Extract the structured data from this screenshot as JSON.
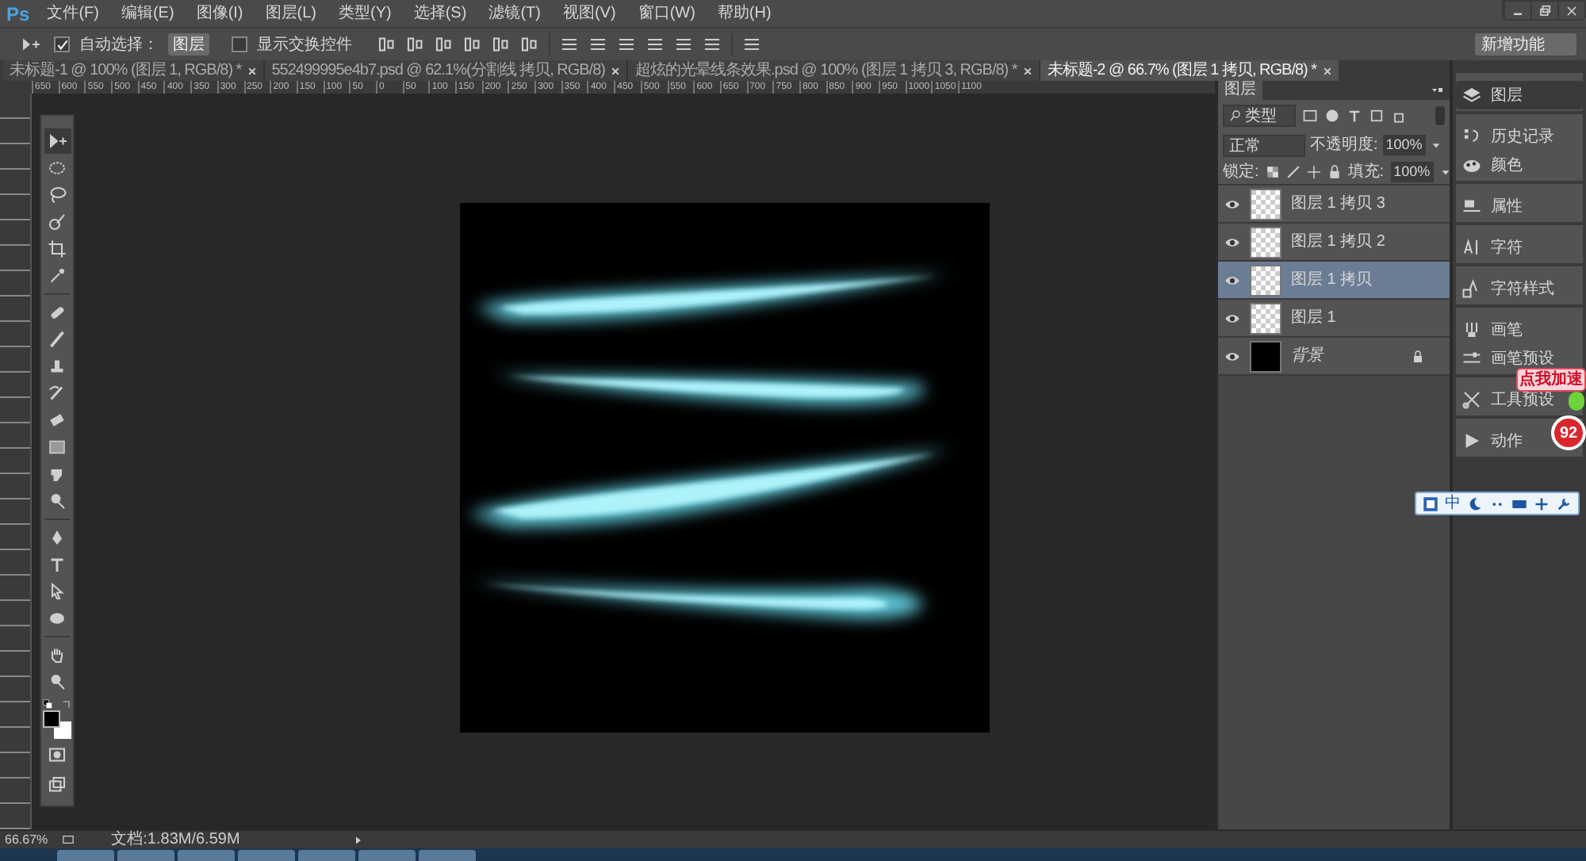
{
  "app_logo": "Ps",
  "menu": [
    "文件(F)",
    "编辑(E)",
    "图像(I)",
    "图层(L)",
    "类型(Y)",
    "选择(S)",
    "滤镜(T)",
    "视图(V)",
    "窗口(W)",
    "帮助(H)"
  ],
  "options_bar": {
    "auto_select": {
      "label": "自动选择：",
      "checked": true
    },
    "auto_select_target": "图层",
    "show_transform": {
      "label": "显示交换控件",
      "checked": false
    }
  },
  "workspace": "新增功能",
  "tabs": [
    {
      "label": "未标题-1 @ 100% (图层 1, RGB/8) *",
      "selected": false
    },
    {
      "label": "552499995e4b7.psd @ 62.1%(分割线 拷贝, RGB/8)",
      "selected": false
    },
    {
      "label": "超炫的光晕线条效果.psd @ 100% (图层 1 拷贝 3, RGB/8) *",
      "selected": false
    },
    {
      "label": "未标题-2 @ 66.7% (图层 1 拷贝, RGB/8) *",
      "selected": true
    }
  ],
  "ruler": [
    "650",
    "600",
    "550",
    "500",
    "450",
    "400",
    "350",
    "300",
    "250",
    "200",
    "150",
    "100",
    "50",
    "0",
    "50",
    "100",
    "150",
    "200",
    "250",
    "300",
    "350",
    "400",
    "450",
    "500",
    "550",
    "600",
    "650",
    "700",
    "750",
    "800",
    "850",
    "900",
    "950",
    "1000",
    "1050",
    "1100"
  ],
  "layers_panel": {
    "title": "图层",
    "filter": "类型",
    "blend_mode": "正常",
    "opacity_label": "不透明度:",
    "opacity": "100%",
    "lock_label": "锁定:",
    "fill_label": "填充:",
    "fill": "100%",
    "layers": [
      {
        "name": "图层 1 拷贝 3",
        "kind": "transparent",
        "visible": true,
        "selected": false,
        "locked": false
      },
      {
        "name": "图层 1 拷贝 2",
        "kind": "transparent",
        "visible": true,
        "selected": false,
        "locked": false
      },
      {
        "name": "图层 1 拷贝",
        "kind": "transparent",
        "visible": true,
        "selected": true,
        "locked": false
      },
      {
        "name": "图层 1",
        "kind": "transparent",
        "visible": true,
        "selected": false,
        "locked": false
      },
      {
        "name": "背景",
        "kind": "background",
        "visible": true,
        "selected": false,
        "locked": true
      }
    ]
  },
  "dock": [
    {
      "label": "图层",
      "selected": true
    },
    {
      "label": "历史记录",
      "selected": false
    },
    {
      "label": "颜色",
      "selected": false
    },
    {
      "label": "属性",
      "selected": false
    },
    {
      "label": "字符",
      "selected": false
    },
    {
      "label": "字符样式",
      "selected": false
    },
    {
      "label": "画笔",
      "selected": false
    },
    {
      "label": "画笔预设",
      "selected": false
    },
    {
      "label": "工具预设",
      "selected": false
    },
    {
      "label": "动作",
      "selected": false
    }
  ],
  "overlay": {
    "badge": "点我加速",
    "counter": "92"
  },
  "ime_toolbar": {
    "mode": "中"
  },
  "status_bar": {
    "zoom": "66.67%",
    "doc_info": "文档:1.83M/6.59M"
  }
}
